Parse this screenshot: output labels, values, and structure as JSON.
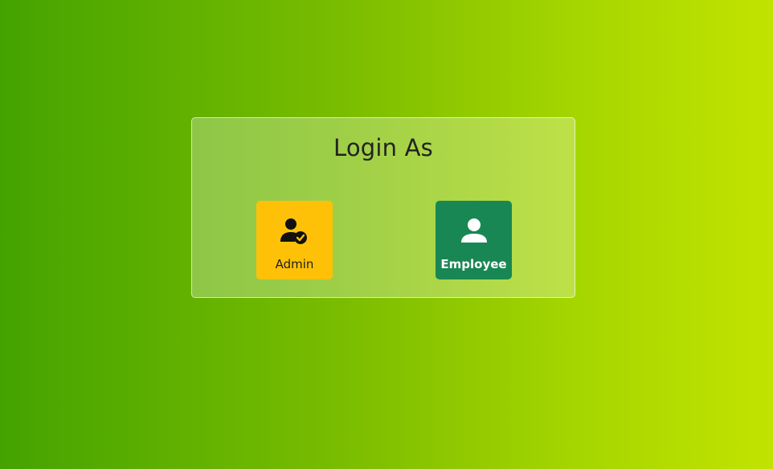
{
  "page": {
    "background_colors": [
      "#44a300",
      "#c2e300"
    ]
  },
  "login_card": {
    "title": "Login As",
    "roles": [
      {
        "label": "Admin",
        "icon": "user-check-icon",
        "color": "#ffc107"
      },
      {
        "label": "Employee",
        "icon": "user-icon",
        "color": "#198754"
      }
    ]
  }
}
